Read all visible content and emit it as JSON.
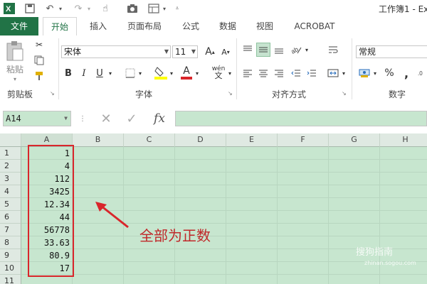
{
  "window": {
    "title": "工作簿1 - Ex"
  },
  "tabs": [
    "文件",
    "开始",
    "插入",
    "页面布局",
    "公式",
    "数据",
    "视图",
    "ACROBAT"
  ],
  "ribbon": {
    "clipboard": {
      "paste_label": "粘贴",
      "group_label": "剪贴板"
    },
    "font": {
      "font_name": "宋体",
      "font_size": "11",
      "group_label": "字体",
      "bold": "B",
      "italic": "I",
      "underline": "U",
      "grow": "A",
      "shrink": "A",
      "font_color": "A",
      "phonetic": "wén"
    },
    "alignment": {
      "group_label": "对齐方式"
    },
    "number": {
      "format": "常规",
      "group_label": "数字",
      "percent": "%",
      "comma": ","
    }
  },
  "formula_bar": {
    "name_box": "A14",
    "fx": "fx",
    "formula": ""
  },
  "sheet": {
    "columns": [
      "A",
      "B",
      "C",
      "D",
      "E",
      "F",
      "G",
      "H"
    ],
    "rows": [
      {
        "num": "1",
        "a": "1"
      },
      {
        "num": "2",
        "a": "4"
      },
      {
        "num": "3",
        "a": "112"
      },
      {
        "num": "4",
        "a": "3425"
      },
      {
        "num": "5",
        "a": "12.34"
      },
      {
        "num": "6",
        "a": "44"
      },
      {
        "num": "7",
        "a": "56778"
      },
      {
        "num": "8",
        "a": "33.63"
      },
      {
        "num": "9",
        "a": "80.9"
      },
      {
        "num": "10",
        "a": "17"
      },
      {
        "num": "11",
        "a": ""
      }
    ]
  },
  "annotation": {
    "text": "全部为正数"
  },
  "watermark": {
    "line1": "搜狗指南",
    "line2": "zhinan.sogou.com"
  },
  "colors": {
    "excel_green": "#217346",
    "sheet_bg": "#c7e6cf",
    "annotation_red": "#d9262b"
  }
}
